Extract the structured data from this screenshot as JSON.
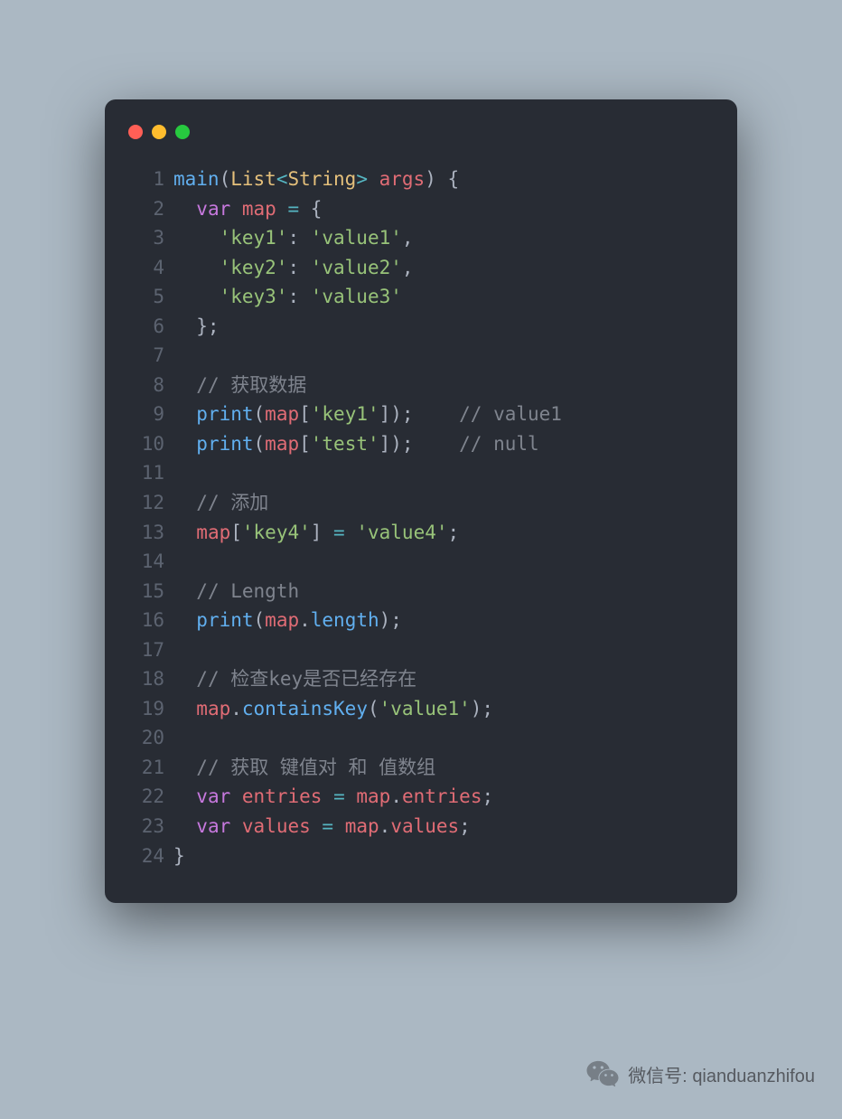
{
  "lines": [
    {
      "n": "1",
      "tokens": [
        {
          "t": "main",
          "c": "fn"
        },
        {
          "t": "(",
          "c": "pn"
        },
        {
          "t": "List",
          "c": "cls"
        },
        {
          "t": "<",
          "c": "op"
        },
        {
          "t": "String",
          "c": "cls"
        },
        {
          "t": ">",
          "c": "op"
        },
        {
          "t": " args",
          "c": "var"
        },
        {
          "t": ") {",
          "c": "pn"
        }
      ]
    },
    {
      "n": "2",
      "tokens": [
        {
          "t": "  ",
          "c": ""
        },
        {
          "t": "var",
          "c": "kw"
        },
        {
          "t": " ",
          "c": ""
        },
        {
          "t": "map",
          "c": "var"
        },
        {
          "t": " ",
          "c": ""
        },
        {
          "t": "=",
          "c": "op"
        },
        {
          "t": " {",
          "c": "pn"
        }
      ]
    },
    {
      "n": "3",
      "tokens": [
        {
          "t": "    ",
          "c": ""
        },
        {
          "t": "'key1'",
          "c": "str"
        },
        {
          "t": ": ",
          "c": "pn"
        },
        {
          "t": "'value1'",
          "c": "str"
        },
        {
          "t": ",",
          "c": "pn"
        }
      ]
    },
    {
      "n": "4",
      "tokens": [
        {
          "t": "    ",
          "c": ""
        },
        {
          "t": "'key2'",
          "c": "str"
        },
        {
          "t": ": ",
          "c": "pn"
        },
        {
          "t": "'value2'",
          "c": "str"
        },
        {
          "t": ",",
          "c": "pn"
        }
      ]
    },
    {
      "n": "5",
      "tokens": [
        {
          "t": "    ",
          "c": ""
        },
        {
          "t": "'key3'",
          "c": "str"
        },
        {
          "t": ": ",
          "c": "pn"
        },
        {
          "t": "'value3'",
          "c": "str"
        }
      ]
    },
    {
      "n": "6",
      "tokens": [
        {
          "t": "  };",
          "c": "pn"
        }
      ]
    },
    {
      "n": "7",
      "tokens": [
        {
          "t": " ",
          "c": ""
        }
      ]
    },
    {
      "n": "8",
      "tokens": [
        {
          "t": "  ",
          "c": ""
        },
        {
          "t": "// 获取数据",
          "c": "cmt"
        }
      ]
    },
    {
      "n": "9",
      "tokens": [
        {
          "t": "  ",
          "c": ""
        },
        {
          "t": "print",
          "c": "fn"
        },
        {
          "t": "(",
          "c": "pn"
        },
        {
          "t": "map",
          "c": "var"
        },
        {
          "t": "[",
          "c": "pn"
        },
        {
          "t": "'key1'",
          "c": "str"
        },
        {
          "t": "]);    ",
          "c": "pn"
        },
        {
          "t": "// value1",
          "c": "cmt"
        }
      ]
    },
    {
      "n": "10",
      "tokens": [
        {
          "t": "  ",
          "c": ""
        },
        {
          "t": "print",
          "c": "fn"
        },
        {
          "t": "(",
          "c": "pn"
        },
        {
          "t": "map",
          "c": "var"
        },
        {
          "t": "[",
          "c": "pn"
        },
        {
          "t": "'test'",
          "c": "str"
        },
        {
          "t": "]);    ",
          "c": "pn"
        },
        {
          "t": "// null",
          "c": "cmt"
        }
      ]
    },
    {
      "n": "11",
      "tokens": [
        {
          "t": " ",
          "c": ""
        }
      ]
    },
    {
      "n": "12",
      "tokens": [
        {
          "t": "  ",
          "c": ""
        },
        {
          "t": "// 添加",
          "c": "cmt"
        }
      ]
    },
    {
      "n": "13",
      "tokens": [
        {
          "t": "  ",
          "c": ""
        },
        {
          "t": "map",
          "c": "var"
        },
        {
          "t": "[",
          "c": "pn"
        },
        {
          "t": "'key4'",
          "c": "str"
        },
        {
          "t": "] ",
          "c": "pn"
        },
        {
          "t": "=",
          "c": "op"
        },
        {
          "t": " ",
          "c": ""
        },
        {
          "t": "'value4'",
          "c": "str"
        },
        {
          "t": ";",
          "c": "pn"
        }
      ]
    },
    {
      "n": "14",
      "tokens": [
        {
          "t": " ",
          "c": ""
        }
      ]
    },
    {
      "n": "15",
      "tokens": [
        {
          "t": "  ",
          "c": ""
        },
        {
          "t": "// Length",
          "c": "cmt"
        }
      ]
    },
    {
      "n": "16",
      "tokens": [
        {
          "t": "  ",
          "c": ""
        },
        {
          "t": "print",
          "c": "fn"
        },
        {
          "t": "(",
          "c": "pn"
        },
        {
          "t": "map",
          "c": "var"
        },
        {
          "t": ".",
          "c": "pn"
        },
        {
          "t": "length",
          "c": "fn"
        },
        {
          "t": ");",
          "c": "pn"
        }
      ]
    },
    {
      "n": "17",
      "tokens": [
        {
          "t": " ",
          "c": ""
        }
      ]
    },
    {
      "n": "18",
      "tokens": [
        {
          "t": "  ",
          "c": ""
        },
        {
          "t": "// 检查key是否已经存在",
          "c": "cmt"
        }
      ]
    },
    {
      "n": "19",
      "tokens": [
        {
          "t": "  ",
          "c": ""
        },
        {
          "t": "map",
          "c": "var"
        },
        {
          "t": ".",
          "c": "pn"
        },
        {
          "t": "containsKey",
          "c": "fn"
        },
        {
          "t": "(",
          "c": "pn"
        },
        {
          "t": "'value1'",
          "c": "str"
        },
        {
          "t": ");",
          "c": "pn"
        }
      ]
    },
    {
      "n": "20",
      "tokens": [
        {
          "t": " ",
          "c": ""
        }
      ]
    },
    {
      "n": "21",
      "tokens": [
        {
          "t": "  ",
          "c": ""
        },
        {
          "t": "// 获取 键值对 和 值数组",
          "c": "cmt"
        }
      ]
    },
    {
      "n": "22",
      "tokens": [
        {
          "t": "  ",
          "c": ""
        },
        {
          "t": "var",
          "c": "kw"
        },
        {
          "t": " ",
          "c": ""
        },
        {
          "t": "entries",
          "c": "var"
        },
        {
          "t": " ",
          "c": ""
        },
        {
          "t": "=",
          "c": "op"
        },
        {
          "t": " ",
          "c": ""
        },
        {
          "t": "map",
          "c": "var"
        },
        {
          "t": ".",
          "c": "pn"
        },
        {
          "t": "entries",
          "c": "var"
        },
        {
          "t": ";",
          "c": "pn"
        }
      ]
    },
    {
      "n": "23",
      "tokens": [
        {
          "t": "  ",
          "c": ""
        },
        {
          "t": "var",
          "c": "kw"
        },
        {
          "t": " ",
          "c": ""
        },
        {
          "t": "values",
          "c": "var"
        },
        {
          "t": " ",
          "c": ""
        },
        {
          "t": "=",
          "c": "op"
        },
        {
          "t": " ",
          "c": ""
        },
        {
          "t": "map",
          "c": "var"
        },
        {
          "t": ".",
          "c": "pn"
        },
        {
          "t": "values",
          "c": "var"
        },
        {
          "t": ";",
          "c": "pn"
        }
      ]
    },
    {
      "n": "24",
      "tokens": [
        {
          "t": "}",
          "c": "pn"
        }
      ]
    }
  ],
  "wechat": {
    "prefix": "微信号:",
    "handle": "qianduanzhifou"
  }
}
